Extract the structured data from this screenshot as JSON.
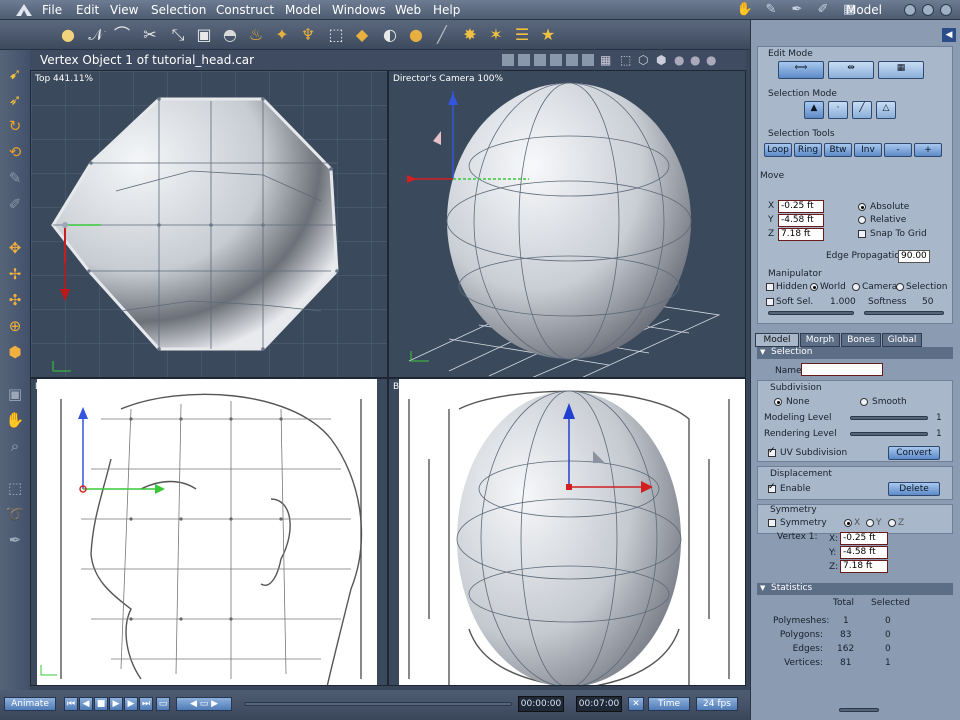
{
  "menubar": {
    "items": [
      "File",
      "Edit",
      "View",
      "Selection",
      "Construct",
      "Model",
      "Windows",
      "Web",
      "Help"
    ],
    "room_title": "Model"
  },
  "viewport": {
    "doc_title": "Vertex Object 1 of tutorial_head.car",
    "top_label": "Top 441.11%",
    "camera_label": "Director's Camera 100%",
    "left_label": "L",
    "back_label": "Back"
  },
  "edit_panel": {
    "edit_mode_title": "Edit Mode",
    "selection_mode_title": "Selection Mode",
    "selection_tools_title": "Selection Tools",
    "tools": [
      "Loop",
      "Ring",
      "Btw",
      "Inv",
      "-",
      "+"
    ],
    "move_title": "Move",
    "x_label": "X",
    "x_value": "-0.25 ft",
    "y_label": "Y",
    "y_value": "-4.58 ft",
    "z_label": "Z",
    "z_value": "7.18 ft",
    "absolute": "Absolute",
    "relative": "Relative",
    "snap": "Snap To Grid",
    "edge_prop_label": "Edge Propagation",
    "edge_prop_value": "90.00",
    "manipulator_title": "Manipulator",
    "hidden": "Hidden",
    "world": "World",
    "camera": "Camera",
    "selection": "Selection",
    "soft_sel": "Soft Sel.",
    "soft_sel_value": "1.000",
    "softness": "Softness",
    "softness_value": "50"
  },
  "model_panel": {
    "tabs": [
      "Model",
      "Morph",
      "Bones",
      "Global"
    ],
    "selection_head": "Selection",
    "name_label": "Name",
    "subdivision_title": "Subdivision",
    "none": "None",
    "smooth": "Smooth",
    "modeling_level": "Modeling Level",
    "modeling_level_value": "1",
    "rendering_level": "Rendering Level",
    "rendering_level_value": "1",
    "uv_subdivision": "UV Subdivision",
    "convert": "Convert",
    "displacement_title": "Displacement",
    "enable": "Enable",
    "delete": "Delete",
    "symmetry_title": "Symmetry",
    "symmetry": "Symmetry",
    "axis_x": "X",
    "axis_y": "Y",
    "axis_z": "Z",
    "vertex_label": "Vertex 1:",
    "vx_label": "X:",
    "vx": "-0.25 ft",
    "vy_label": "Y:",
    "vy": "-4.58 ft",
    "vz_label": "Z:",
    "vz": "7.18 ft"
  },
  "statistics": {
    "head": "Statistics",
    "col_total": "Total",
    "col_selected": "Selected",
    "rows": [
      {
        "label": "Polymeshes:",
        "total": "1",
        "selected": "0"
      },
      {
        "label": "Polygons:",
        "total": "83",
        "selected": "0"
      },
      {
        "label": "Edges:",
        "total": "162",
        "selected": "0"
      },
      {
        "label": "Vertices:",
        "total": "81",
        "selected": "1"
      }
    ]
  },
  "timeline": {
    "animate": "Animate",
    "time_current": "00:00:00",
    "time_end": "00:07:00",
    "time_mode": "Time",
    "fps": "24 fps"
  }
}
